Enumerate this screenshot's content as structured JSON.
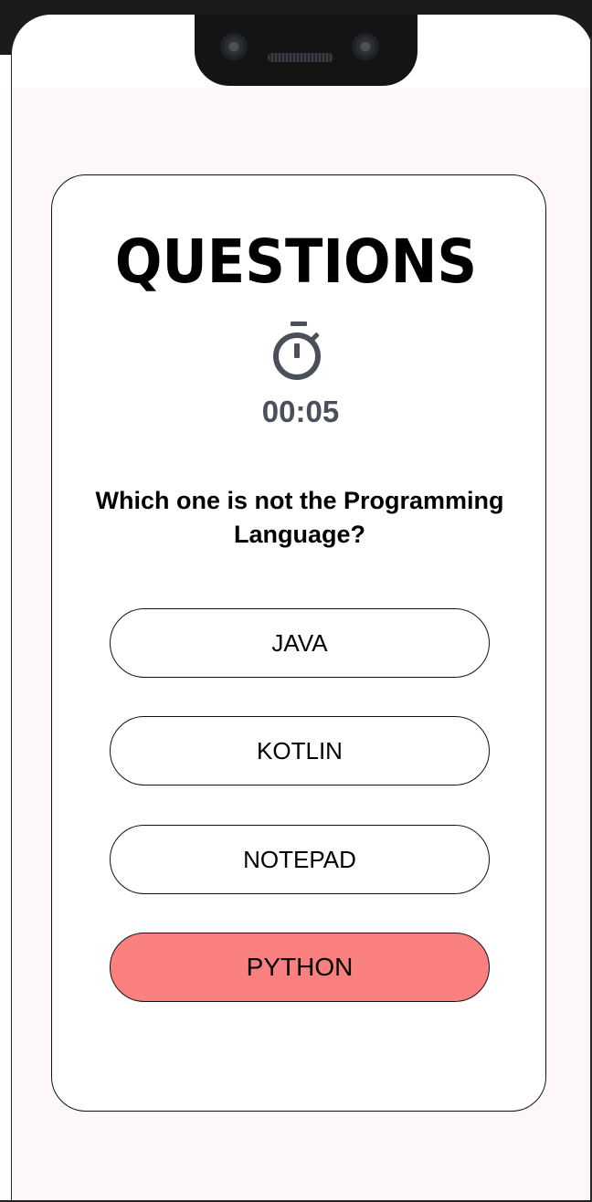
{
  "quiz": {
    "title": "QUESTIONS",
    "timer": "00:05",
    "question": "Which one is not the Programming Language?",
    "options": [
      {
        "label": "JAVA",
        "selected": false
      },
      {
        "label": "KOTLIN",
        "selected": false
      },
      {
        "label": "NOTEPAD",
        "selected": false
      },
      {
        "label": "PYTHON",
        "selected": true
      }
    ]
  },
  "colors": {
    "background": "#fdf7fa",
    "card": "#ffffff",
    "selected_option": "#fa7f7f",
    "timer": "#4a4f5a"
  },
  "icons": {
    "timer": "stopwatch-icon"
  }
}
